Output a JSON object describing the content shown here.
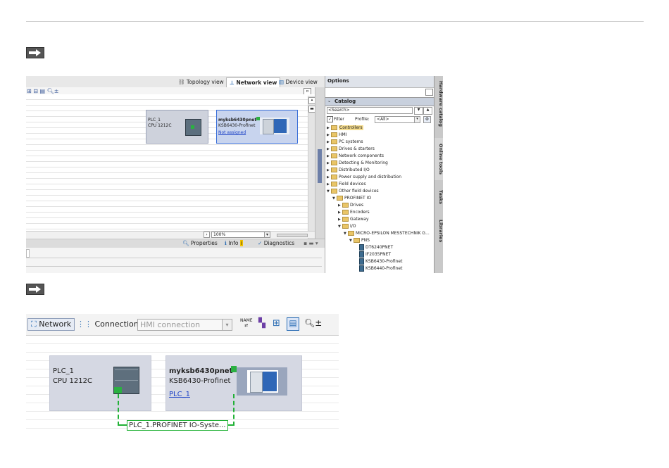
{
  "shot1": {
    "view_tabs": {
      "topology": "Topology view",
      "network": "Network view",
      "device": "Device view"
    },
    "devices": [
      {
        "name": "PLC_1",
        "type": "CPU 1212C"
      },
      {
        "name": "myksb6430pnet",
        "type": "KSB6430-Profinet",
        "status": "Not assigned"
      }
    ],
    "zoom": "100%",
    "bottom_tabs": {
      "properties": "Properties",
      "info": "Info",
      "diagnostics": "Diagnostics"
    },
    "catalog": {
      "options_title": "Options",
      "section_title": "Catalog",
      "search_placeholder": "<Search>",
      "filter_label": "Filter",
      "profile_label": "Profile:",
      "profile_value": "<All>",
      "tree": [
        {
          "label": "Controllers",
          "level": 0,
          "icon": "folder",
          "expanded": false,
          "highlight": true
        },
        {
          "label": "HMI",
          "level": 0,
          "icon": "folder",
          "expanded": false
        },
        {
          "label": "PC systems",
          "level": 0,
          "icon": "folder",
          "expanded": false
        },
        {
          "label": "Drives & starters",
          "level": 0,
          "icon": "folder",
          "expanded": false
        },
        {
          "label": "Network components",
          "level": 0,
          "icon": "folder",
          "expanded": false
        },
        {
          "label": "Detecting & Monitoring",
          "level": 0,
          "icon": "folder",
          "expanded": false
        },
        {
          "label": "Distributed I/O",
          "level": 0,
          "icon": "folder",
          "expanded": false
        },
        {
          "label": "Power supply and distribution",
          "level": 0,
          "icon": "folder",
          "expanded": false
        },
        {
          "label": "Field devices",
          "level": 0,
          "icon": "folder",
          "expanded": false
        },
        {
          "label": "Other field devices",
          "level": 0,
          "icon": "folder",
          "expanded": true
        },
        {
          "label": "PROFINET IO",
          "level": 1,
          "icon": "folder",
          "expanded": true
        },
        {
          "label": "Drives",
          "level": 2,
          "icon": "folder",
          "expanded": false
        },
        {
          "label": "Encoders",
          "level": 2,
          "icon": "folder",
          "expanded": false
        },
        {
          "label": "Gateway",
          "level": 2,
          "icon": "folder",
          "expanded": false
        },
        {
          "label": "I/O",
          "level": 2,
          "icon": "folder",
          "expanded": true
        },
        {
          "label": "MICRO-EPSILON MESSTECHNIK G...",
          "level": 3,
          "icon": "folder",
          "expanded": true
        },
        {
          "label": "PNS",
          "level": 4,
          "icon": "folder",
          "expanded": true
        },
        {
          "label": "DT6240PNET",
          "level": 5,
          "icon": "module"
        },
        {
          "label": "IF2035PNET",
          "level": 5,
          "icon": "module"
        },
        {
          "label": "KSB6430-Profinet",
          "level": 5,
          "icon": "module"
        },
        {
          "label": "KSB6440-Profinet",
          "level": 5,
          "icon": "module"
        }
      ]
    },
    "side_tabs": [
      "Hardware catalog",
      "Online tools",
      "Tasks",
      "Libraries"
    ]
  },
  "shot2": {
    "toolbar": {
      "network_label": "Network",
      "connections_label": "Connections",
      "connection_type": "HMI connection",
      "name_icon_label": "NAME"
    },
    "devices": [
      {
        "name": "PLC_1",
        "type": "CPU 1212C"
      },
      {
        "name": "myksb6430pnet",
        "type": "KSB6430-Profinet",
        "assigned": "PLC_1"
      }
    ],
    "io_system_label": "PLC_1.PROFINET IO-Syste..."
  },
  "colors": {
    "profinet_green": "#21b136",
    "selection_blue": "#3a6fd8",
    "link_blue": "#2146c7"
  }
}
